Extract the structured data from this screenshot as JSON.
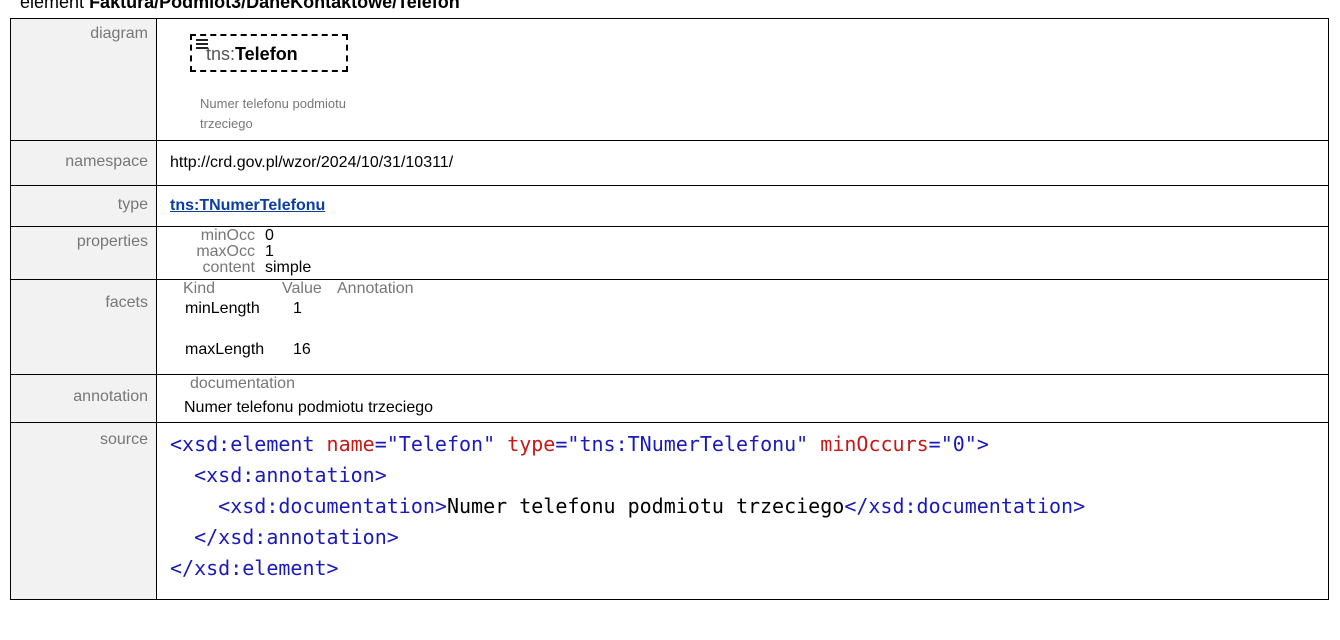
{
  "heading": {
    "prefix": "element",
    "path": "Faktura/Podmiot3/DaneKontaktowe/Telefon"
  },
  "labels": {
    "diagram": "diagram",
    "namespace": "namespace",
    "type": "type",
    "properties": "properties",
    "facets": "facets",
    "annotation": "annotation",
    "source": "source"
  },
  "diagram": {
    "prefix": "tns:",
    "name": "Telefon",
    "documentation_line1": "Numer telefonu podmiotu",
    "documentation_line2": "trzeciego"
  },
  "namespace": "http://crd.gov.pl/wzor/2024/10/31/10311/",
  "type": "tns:TNumerTelefonu",
  "properties": [
    {
      "key": "minOcc",
      "value": "0"
    },
    {
      "key": "maxOcc",
      "value": "1"
    },
    {
      "key": "content",
      "value": "simple"
    }
  ],
  "facets": {
    "headers": {
      "kind": "Kind",
      "value": "Value",
      "annotation": "Annotation"
    },
    "rows": [
      {
        "kind": "minLength",
        "value": "1"
      },
      {
        "kind": "maxLength",
        "value": "16"
      }
    ]
  },
  "annotation": {
    "key": "documentation",
    "value": "Numer telefonu podmiotu trzeciego"
  },
  "source": {
    "l1_open": "<xsd:element",
    "l1_attr1": "name",
    "l1_val1": "\"Telefon\"",
    "l1_attr2": "type",
    "l1_val2": "\"tns:TNumerTelefonu\"",
    "l1_attr3": "minOccurs",
    "l1_val3": "\"0\"",
    "l1_close": ">",
    "eq": "=",
    "l2": "<xsd:annotation>",
    "l3_open": "<xsd:documentation>",
    "l3_text": "Numer telefonu podmiotu trzeciego",
    "l3_close": "</xsd:documentation>",
    "l4": "</xsd:annotation>",
    "l5": "</xsd:element>"
  }
}
